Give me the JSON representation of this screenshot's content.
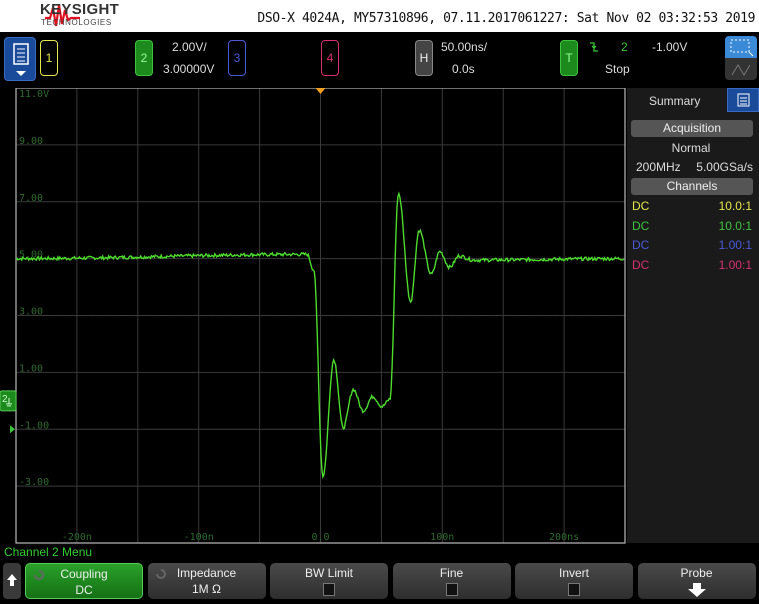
{
  "header": {
    "brand": "KEYSIGHT",
    "brand_sub": "TECHNOLOGIES",
    "device_info": "DSO-X 4024A, MY57310896, 07.11.2017061227: Sat Nov 02 03:32:53 2019"
  },
  "topbar": {
    "ch1": {
      "label": "1",
      "color": "#e6e64a"
    },
    "ch2": {
      "label": "2",
      "color": "#3cc43c",
      "scale": "2.00V/",
      "offset": "3.00000V"
    },
    "ch3": {
      "label": "3",
      "color": "#4a5ad8"
    },
    "ch4": {
      "label": "4",
      "color": "#d83070"
    },
    "horizontal": {
      "label": "H",
      "scale": "50.00ns/",
      "delay": "0.0s"
    },
    "trigger": {
      "label": "T",
      "slope_icon": "falling-edge-icon",
      "source": "2",
      "level": "-1.00V",
      "status": "Stop"
    }
  },
  "plot": {
    "y_labels": [
      "11.0V",
      "9.00",
      "7.00",
      "5.00",
      "3.00",
      "1.00",
      "-1.00",
      "-3.00"
    ],
    "x_labels": [
      "-200n",
      "-100n",
      "0.0",
      "100n",
      "200ns"
    ],
    "channel_marker": "2",
    "trace_color": "#4cdc2c"
  },
  "chart_data": {
    "type": "line",
    "xlim": [
      -250,
      250
    ],
    "ylim": [
      -5,
      11
    ],
    "x_unit": "ns",
    "y_unit": "V",
    "series": [
      {
        "points": [
          [
            -250,
            5.0
          ],
          [
            -11,
            5.15
          ],
          [
            -5.5,
            4.6
          ],
          [
            2,
            -2.65
          ],
          [
            11,
            1.45
          ],
          [
            18.6,
            -0.95
          ],
          [
            27,
            0.4
          ],
          [
            35,
            -0.35
          ],
          [
            43,
            0.15
          ],
          [
            50.5,
            -0.2
          ],
          [
            57,
            0.05
          ],
          [
            64,
            7.3
          ],
          [
            74,
            3.5
          ],
          [
            81,
            6.0
          ],
          [
            91,
            4.45
          ],
          [
            98,
            5.25
          ],
          [
            106,
            4.7
          ],
          [
            114,
            5.1
          ],
          [
            125,
            4.95
          ],
          [
            250,
            5.0
          ]
        ]
      }
    ]
  },
  "side": {
    "tab": "Summary",
    "acq_button": "Acquisition",
    "acq_mode": "Normal",
    "bandwidth": "200MHz",
    "sample_rate": "5.00GSa/s",
    "channels_button": "Channels",
    "channels": [
      {
        "coupling": "DC",
        "probe": "10.0:1",
        "color": "#e6e64a"
      },
      {
        "coupling": "DC",
        "probe": "10.0:1",
        "color": "#3cc43c"
      },
      {
        "coupling": "DC",
        "probe": "1.00:1",
        "color": "#4a5ad8"
      },
      {
        "coupling": "DC",
        "probe": "1.00:1",
        "color": "#d83070"
      }
    ]
  },
  "menu": {
    "title": "Channel 2 Menu",
    "softkeys": [
      {
        "label": "Coupling",
        "value": "DC"
      },
      {
        "label": "Impedance",
        "value": "1M Ω"
      },
      {
        "label": "BW Limit"
      },
      {
        "label": "Fine"
      },
      {
        "label": "Invert"
      },
      {
        "label": "Probe"
      }
    ]
  }
}
